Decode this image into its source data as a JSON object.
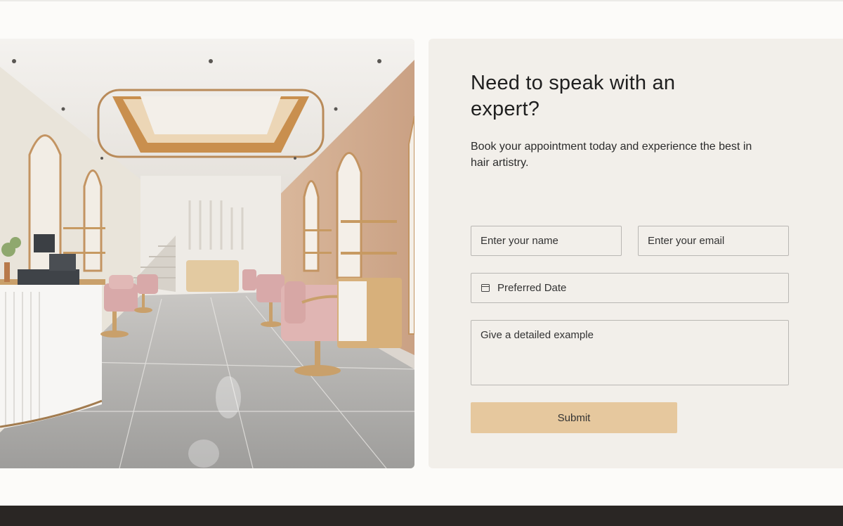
{
  "contact": {
    "heading": "Need to speak with an expert?",
    "subtext": "Book your appointment today and experience the best in hair artistry.",
    "name_placeholder": "Enter your name",
    "email_placeholder": "Enter your email",
    "date_label": "Preferred Date",
    "message_placeholder": "Give a detailed example",
    "submit_label": "Submit"
  },
  "colors": {
    "page_bg": "#fcfbf9",
    "panel_bg": "#f2efea",
    "button_bg": "#e6c89e",
    "footer_bg": "#2a2624"
  },
  "icons": {
    "date": "calendar-icon"
  }
}
